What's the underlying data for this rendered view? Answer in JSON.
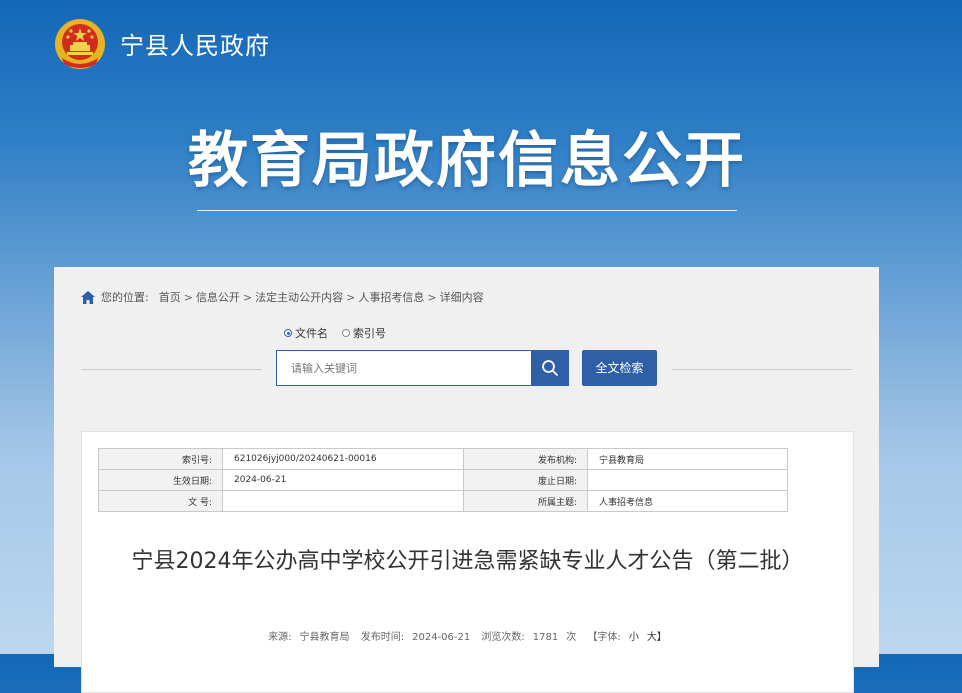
{
  "header": {
    "site_name": "宁县人民政府",
    "big_title": "教育局政府信息公开"
  },
  "breadcrumb": {
    "label": "您的位置:",
    "items": [
      "首页",
      "信息公开",
      "法定主动公开内容",
      "人事招考信息",
      "详细内容"
    ],
    "separator": ">"
  },
  "search": {
    "radio_options": [
      "文件名",
      "索引号"
    ],
    "selected": "文件名",
    "placeholder": "请输入关键词",
    "fulltext_button": "全文检索"
  },
  "meta_table": {
    "index_label": "索引号:",
    "index_value": "621026jyj000/20240621-00016",
    "publisher_label": "发布机构:",
    "publisher_value": "宁县教育局",
    "effective_label": "生效日期:",
    "effective_value": "2024-06-21",
    "expire_label": "废止日期:",
    "expire_value": "",
    "docno_label": "文 号:",
    "docno_value": "",
    "topic_label": "所属主题:",
    "topic_value": "人事招考信息"
  },
  "document": {
    "title": "宁县2024年公办高中学校公开引进急需紧缺专业人才公告（第二批）",
    "source_label": "来源:",
    "source_value": "宁县教育局",
    "date_label": "发布时间:",
    "date_value": "2024-06-21",
    "views_label": "浏览次数:",
    "views_value": "1781",
    "views_unit": "次",
    "font_label": "【字体:",
    "font_small": "小",
    "font_large": "大】"
  },
  "colors": {
    "accent": "#2f5fa6",
    "header_top": "#1467b8",
    "panel_bg": "#f0f0f0"
  },
  "icons": [
    "national-emblem-icon",
    "home-icon",
    "search-icon"
  ]
}
